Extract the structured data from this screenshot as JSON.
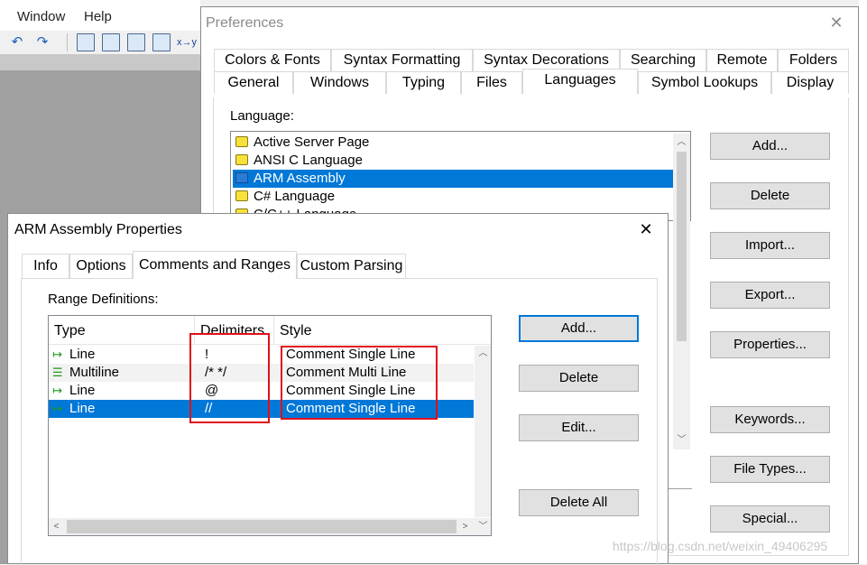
{
  "app": {
    "menu": [
      {
        "label": "Window"
      },
      {
        "label": "Help"
      }
    ]
  },
  "preferences": {
    "title": "Preferences",
    "tabs_row1": [
      "Colors & Fonts",
      "Syntax Formatting",
      "Syntax Decorations",
      "Searching",
      "Remote",
      "Folders"
    ],
    "tabs_row2": [
      "General",
      "Windows",
      "Typing",
      "Files",
      "Languages",
      "Symbol Lookups",
      "Display"
    ],
    "active_tab": "Languages",
    "language_label": "Language:",
    "languages": [
      {
        "name": "Active Server Page",
        "icon": "yellow-doc-icon",
        "selected": false
      },
      {
        "name": "ANSI C Language",
        "icon": "yellow-doc-icon",
        "selected": false
      },
      {
        "name": "ARM Assembly",
        "icon": "blue-toolbox-icon",
        "selected": true
      },
      {
        "name": "C# Language",
        "icon": "yellow-doc-icon",
        "selected": false
      },
      {
        "name": "C/C++ Language",
        "icon": "yellow-doc-icon",
        "selected": false
      }
    ],
    "buttons": [
      "Add...",
      "Delete",
      "Import...",
      "Export...",
      "Properties...",
      "Keywords...",
      "File Types...",
      "Special..."
    ]
  },
  "arm_dialog": {
    "title": "ARM Assembly Properties",
    "tabs": [
      "Info",
      "Options",
      "Comments and Ranges",
      "Custom Parsing"
    ],
    "active_tab": "Comments and Ranges",
    "range_label": "Range Definitions:",
    "columns": [
      "Type",
      "Delimiters",
      "Style"
    ],
    "rows": [
      {
        "type": "Line",
        "delimiters": "!",
        "style": "Comment Single Line",
        "selected": false
      },
      {
        "type": "Multiline",
        "delimiters": "/* */",
        "style": "Comment Multi Line",
        "selected": false
      },
      {
        "type": "Line",
        "delimiters": "@",
        "style": "Comment Single Line",
        "selected": false
      },
      {
        "type": "Line",
        "delimiters": "//",
        "style": "Comment Single Line",
        "selected": true
      }
    ],
    "buttons": [
      "Add...",
      "Delete",
      "Edit...",
      "Delete All"
    ]
  },
  "watermark": "https://blog.csdn.net/weixin_49406295",
  "colors": {
    "selection": "#0078d7",
    "highlight_box": "#e0101a"
  }
}
